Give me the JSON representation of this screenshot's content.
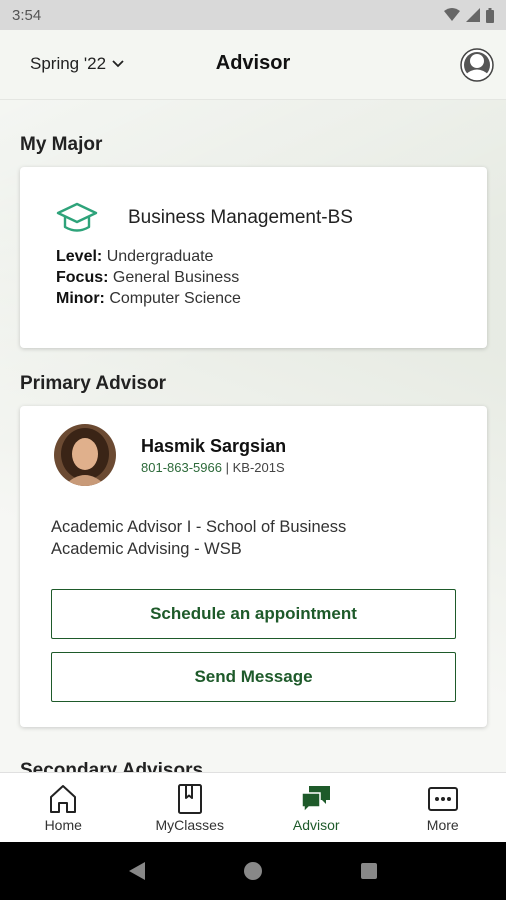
{
  "status_bar": {
    "time": "3:54"
  },
  "app_bar": {
    "term": "Spring '22",
    "title": "Advisor"
  },
  "major_section": {
    "heading": "My Major",
    "major_name": "Business Management-BS",
    "details": [
      {
        "label": "Level:",
        "value": "Undergraduate"
      },
      {
        "label": "Focus:",
        "value": "General Business"
      },
      {
        "label": "Minor:",
        "value": "Computer Science"
      }
    ]
  },
  "advisor_section": {
    "heading": "Primary Advisor",
    "name": "Hasmik Sargsian",
    "phone": "801-863-5966",
    "separator": "|",
    "office": "KB-201S",
    "title_line1": "Academic Advisor I - School of Business",
    "title_line2": "Academic Advising - WSB",
    "schedule_button": "Schedule an appointment",
    "message_button": "Send Message"
  },
  "secondary_section": {
    "heading": "Secondary Advisors"
  },
  "bottom_nav": [
    {
      "label": "Home",
      "icon": "home-icon"
    },
    {
      "label": "MyClasses",
      "icon": "book-icon"
    },
    {
      "label": "Advisor",
      "icon": "chat-icon",
      "active": true
    },
    {
      "label": "More",
      "icon": "more-icon"
    }
  ],
  "colors": {
    "accent": "#1e5a2a",
    "icon_teal": "#2ea37a",
    "background": "#f3f5f1"
  }
}
